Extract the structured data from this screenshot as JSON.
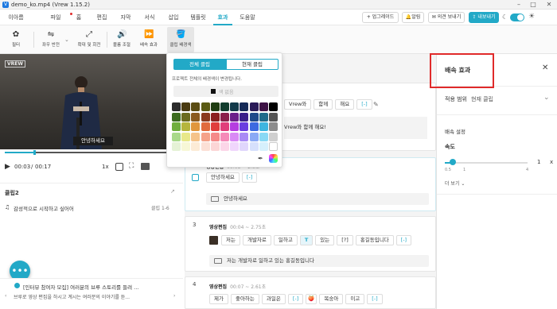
{
  "window": {
    "title": "demo_ko.mp4 (Vrew 1.15.2)",
    "logo": "V"
  },
  "menubar": {
    "user": "이아름",
    "items": [
      {
        "label": "파일"
      },
      {
        "label": "홈"
      },
      {
        "label": "편집"
      },
      {
        "label": "자막"
      },
      {
        "label": "서식"
      },
      {
        "label": "삽입"
      },
      {
        "label": "템플릿"
      },
      {
        "label": "효과"
      },
      {
        "label": "도움말"
      }
    ],
    "active": "효과",
    "upgrade": "+ 업그레이드",
    "notify": "알림",
    "feedback": "의견 보내기",
    "export": "내보내기",
    "accent": "#22a9c7"
  },
  "toolbar": {
    "items": [
      {
        "label": "필터",
        "icon": "palette-icon"
      },
      {
        "label": "좌우 반전",
        "icon": "flip-icon"
      },
      {
        "label": "확대 및 회전",
        "icon": "zoom-rotate-icon"
      },
      {
        "label": "볼륨 조절",
        "icon": "volume-icon"
      },
      {
        "label": "배속 효과",
        "icon": "fast-forward-icon"
      },
      {
        "label": "클립 배경색",
        "icon": "paint-bucket-icon"
      }
    ]
  },
  "player": {
    "watermark": "VREW",
    "caption": "안녕하세요",
    "time_current": "00:03",
    "time_sep": "/",
    "time_total": "00:17",
    "speed": "1x",
    "progress": 0.17
  },
  "left": {
    "clip_title": "클립2",
    "clip_text": "감성적으로 시작하고 싶어어",
    "clip_range": "클립 1-6",
    "notice_title": "[인터뷰 참여자 모집] 여러분의 브루 스토리를 들려 ...",
    "notice_body": "브루로 영상 편집을 하시고 계시는 여러분의 이야기를 듣..."
  },
  "popup": {
    "tab_all": "전체 클립",
    "tab_current": "현재 클립",
    "desc": "프로젝트 전체의 배경색이 변경됩니다.",
    "none_label": "색 없음",
    "colors": [
      [
        "#2b2b2b",
        "#4a3b12",
        "#5a4c12",
        "#5a5a14",
        "#1f3d12",
        "#123d2e",
        "#123a4a",
        "#152a57",
        "#2a1a57",
        "#3d1245",
        "#000000"
      ],
      [
        "#3c6b1f",
        "#6b6b1f",
        "#8a5a1f",
        "#8a3a1f",
        "#8a1f1f",
        "#8a1f4a",
        "#6b1f8a",
        "#3a1f8a",
        "#1f4a8a",
        "#1f6b8a",
        "#555555"
      ],
      [
        "#6fae3d",
        "#b5b53d",
        "#e0963d",
        "#e06a3d",
        "#e03d3d",
        "#e03d7a",
        "#b53de0",
        "#6a3de0",
        "#3d6ae0",
        "#3db5e0",
        "#8c8c8c"
      ],
      [
        "#a9d98a",
        "#e8e88a",
        "#f5c38a",
        "#f5a28a",
        "#f58a8a",
        "#f58ab8",
        "#d98af5",
        "#a98af5",
        "#8aa9f5",
        "#8ad9f5",
        "#cfcfcf"
      ],
      [
        "#e5f2d6",
        "#f7f7d6",
        "#fcebd6",
        "#fce0d6",
        "#fcd6d6",
        "#fcd6e8",
        "#f0d6fc",
        "#e0d6fc",
        "#d6e0fc",
        "#d6f0fc",
        "#ffffff"
      ]
    ]
  },
  "editor": {
    "header": "",
    "clip1": {
      "chips": [
        "Vrew와",
        "함께",
        "해요",
        "[-]"
      ],
      "subtitle": "Vrew와 함께 해요!"
    },
    "clip2": {
      "label": "영상편집",
      "time": "00:03 ~ 2.5초",
      "chips": [
        "안녕하세요",
        "[-]"
      ],
      "subtitle": "안녕하세요"
    },
    "clip3": {
      "num": "3",
      "label": "영상편집",
      "time": "00:04 ~ 2.75초",
      "chips": [
        "저는",
        "개발자로",
        "일하고",
        "있는",
        "[?]",
        "홍길동입니다",
        "[-]"
      ],
      "subtitle": "저는 개발자로 일하고 있는 홍길동입니다"
    },
    "clip4": {
      "num": "4",
      "label": "영상편집",
      "time": "00:07 ~ 2.61초",
      "chips": [
        "제가",
        "좋아하는",
        "과일은",
        "[-]",
        "복숭아",
        "이고",
        "[-]"
      ]
    }
  },
  "right": {
    "title": "배속 효과",
    "scope_label": "적용 범위",
    "scope_value": "현재 클립",
    "settings": "배속 설정",
    "speed_label": "속도",
    "speed_value": "1",
    "speed_unit": "x",
    "min": "0.5",
    "mid": "1",
    "max": "4",
    "speed_fraction": 0.1,
    "more": "더 보기"
  }
}
